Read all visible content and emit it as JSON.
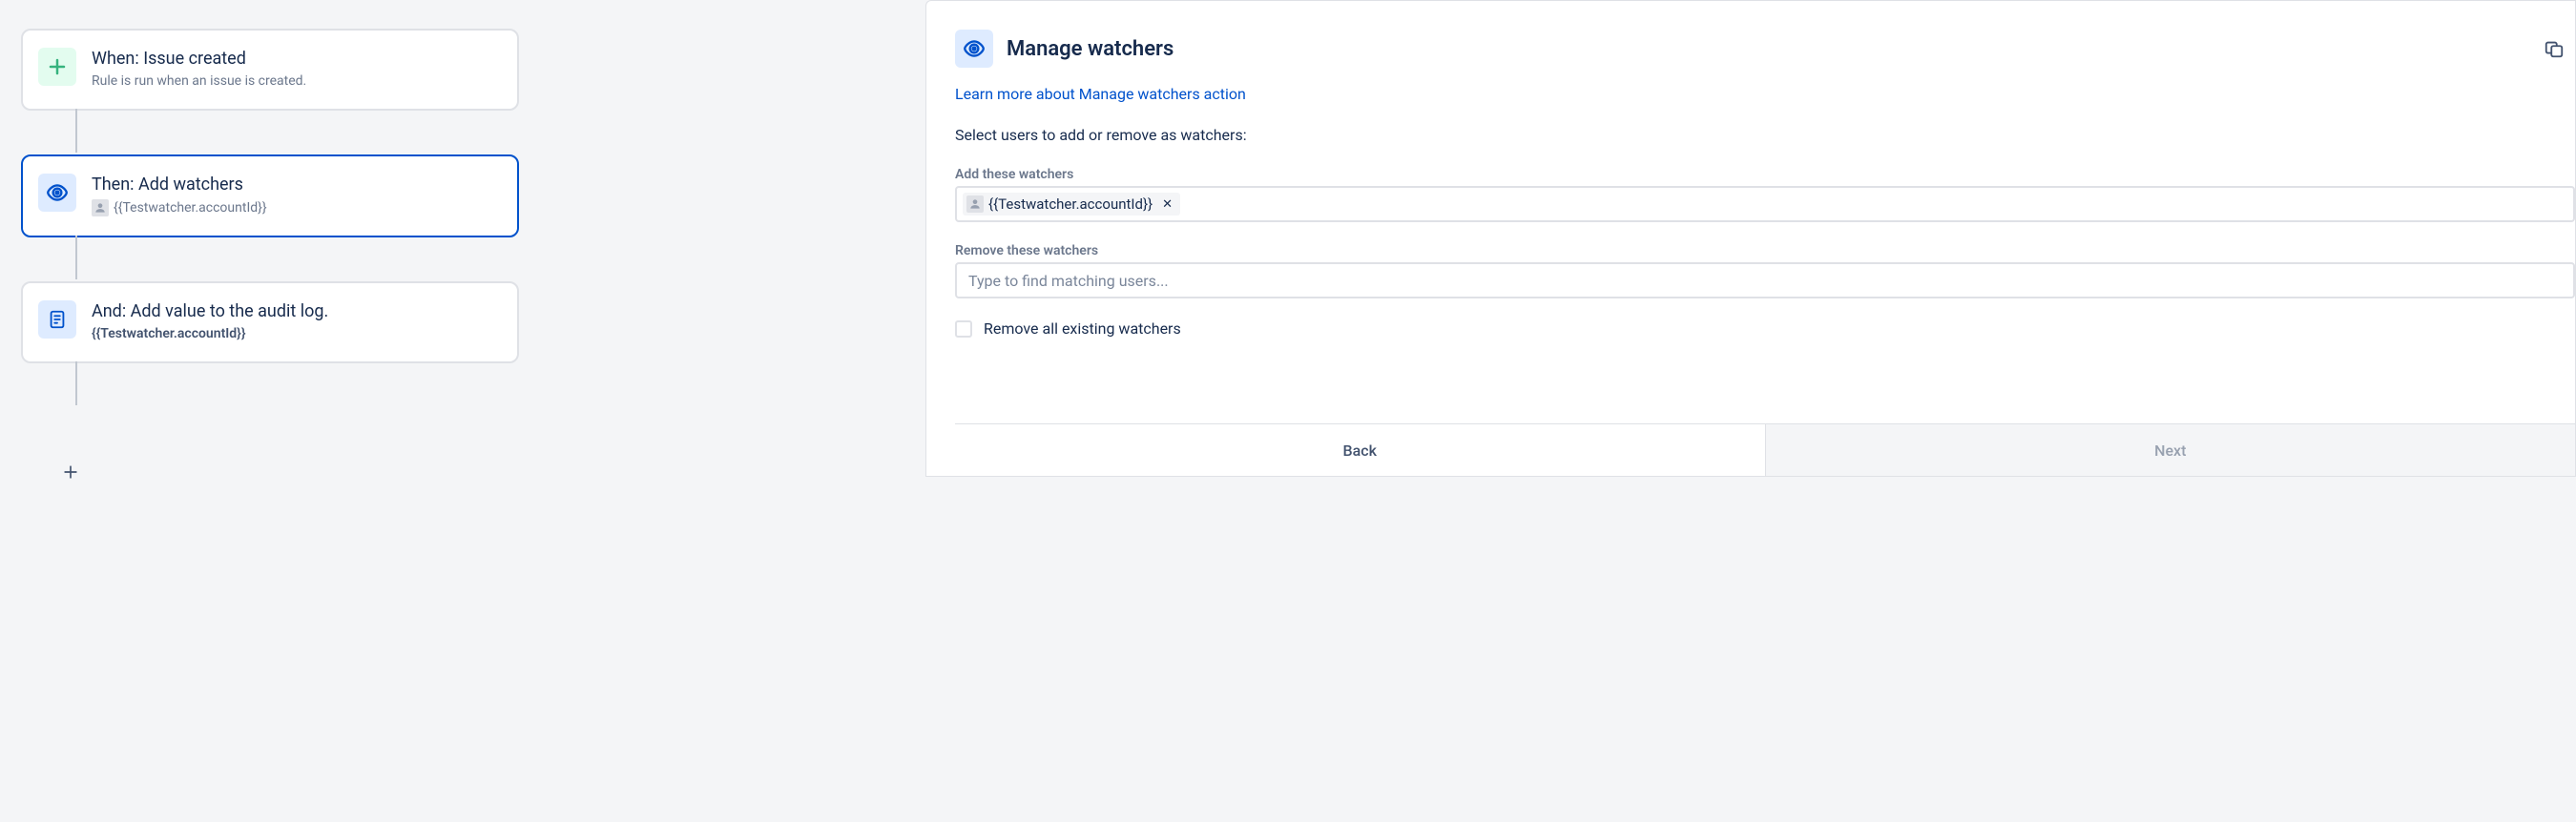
{
  "flow": {
    "cards": [
      {
        "title": "When: Issue created",
        "subtitle": "Rule is run when an issue is created.",
        "watcher": null,
        "icon": "plus",
        "selected": false
      },
      {
        "title": "Then: Add watchers",
        "subtitle": null,
        "watcher": "{{Testwatcher.accountId}}",
        "bold": false,
        "icon": "eye",
        "selected": true
      },
      {
        "title": "And: Add value to the audit log.",
        "subtitle": "{{Testwatcher.accountId}}",
        "watcher": null,
        "bold": true,
        "icon": "doc",
        "selected": false
      }
    ]
  },
  "panel": {
    "title": "Manage watchers",
    "learn_more": "Learn more about Manage watchers action",
    "instruction": "Select users to add or remove as watchers:",
    "add_label": "Add these watchers",
    "add_chip": "{{Testwatcher.accountId}}",
    "remove_label": "Remove these watchers",
    "remove_placeholder": "Type to find matching users...",
    "remove_all_label": "Remove all existing watchers",
    "back_label": "Back",
    "next_label": "Next"
  }
}
